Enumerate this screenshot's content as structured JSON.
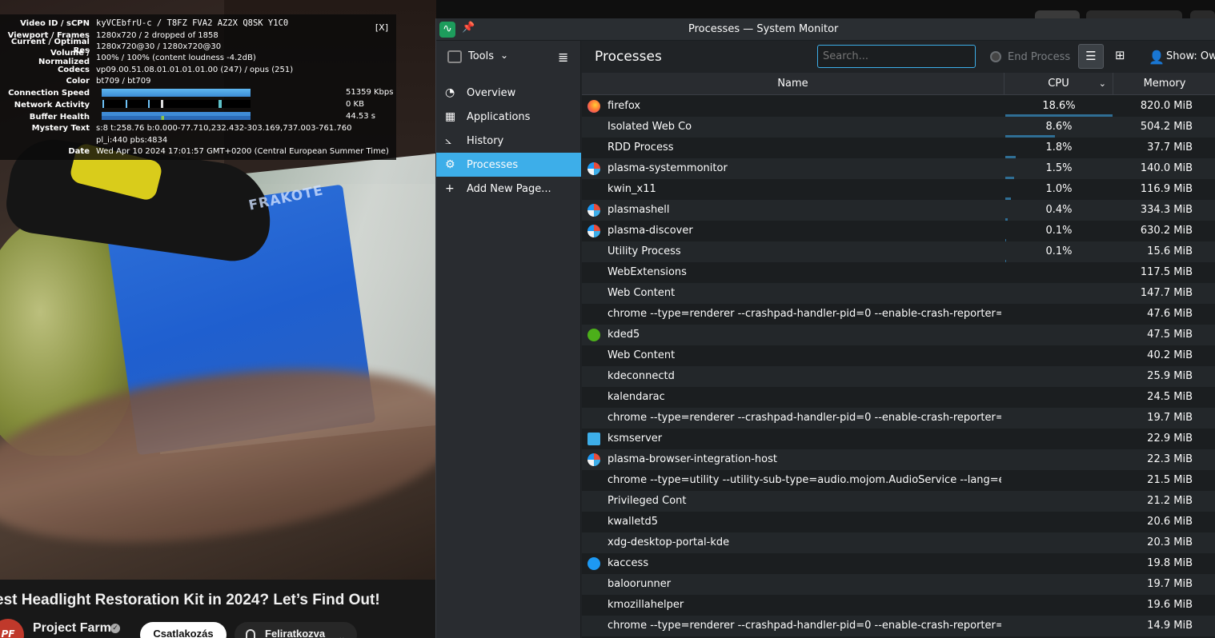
{
  "youtube": {
    "stats": {
      "close": "[X]",
      "rows": [
        {
          "k": "Video ID / sCPN",
          "v": "kyVCEbfrU-c / T8FZ FVA2 AZ2X Q8SK Y1C0"
        },
        {
          "k": "Viewport / Frames",
          "v": "1280x720 / 2 dropped of 1858"
        },
        {
          "k": "Current / Optimal Res",
          "v": "1280x720@30 / 1280x720@30"
        },
        {
          "k": "Volume / Normalized",
          "v": "100% / 100% (content loudness -4.2dB)"
        },
        {
          "k": "Codecs",
          "v": "vp09.00.51.08.01.01.01.01.00 (247) / opus (251)"
        },
        {
          "k": "Color",
          "v": "bt709 / bt709"
        }
      ],
      "connection_speed": {
        "k": "Connection Speed",
        "v": "51359 Kbps"
      },
      "network_activity": {
        "k": "Network Activity",
        "v": "0 KB"
      },
      "buffer_health": {
        "k": "Buffer Health",
        "v": "44.53 s"
      },
      "mystery": {
        "k": "Mystery Text",
        "v1": "s:8 t:258.76 b:0.000-77.710,232.432-303.169,737.003-761.760",
        "v2": "pl_i:440 pbs:4834"
      },
      "date": {
        "k": "Date",
        "v": "Wed Apr 10 2024 17:01:57 GMT+0200 (Central European Summer Time)"
      }
    },
    "video_overlay_text": "FRAKOTE",
    "title": "est Headlight Restoration Kit in 2024? Let’s Find Out!",
    "channel": {
      "avatar_text": "PF",
      "name": "Project Farm",
      "join": "Csatlakozás",
      "subscribe": "Feliratkozva"
    }
  },
  "sysmon": {
    "title": "Processes — System Monitor",
    "tools": "Tools",
    "nav": [
      {
        "label": "Overview",
        "icon": "overview-icon",
        "glyph": "◔"
      },
      {
        "label": "Applications",
        "icon": "applications-icon",
        "glyph": "▪"
      },
      {
        "label": "History",
        "icon": "history-icon",
        "glyph": "⌇"
      },
      {
        "label": "Processes",
        "icon": "processes-icon",
        "glyph": "⚙",
        "active": true
      },
      {
        "label": "Add New Page...",
        "icon": "plus-icon",
        "glyph": "+"
      }
    ],
    "page_title": "Processes",
    "search_placeholder": "Search...",
    "end_process": "End Process",
    "show": "Show: Own",
    "columns": {
      "name": "Name",
      "cpu": "CPU",
      "memory": "Memory"
    },
    "accent": "#3daee9",
    "processes": [
      {
        "name": "firefox",
        "cpu": "18.6%",
        "mem": "820.0 MiB",
        "icon": "firefox"
      },
      {
        "name": "Isolated Web Co",
        "cpu": "8.6%",
        "mem": "504.2 MiB",
        "icon": ""
      },
      {
        "name": "RDD Process",
        "cpu": "1.8%",
        "mem": "37.7 MiB",
        "icon": ""
      },
      {
        "name": "plasma-systemmonitor",
        "cpu": "1.5%",
        "mem": "140.0 MiB",
        "icon": "plasma"
      },
      {
        "name": "kwin_x11",
        "cpu": "1.0%",
        "mem": "116.9 MiB",
        "icon": ""
      },
      {
        "name": "plasmashell",
        "cpu": "0.4%",
        "mem": "334.3 MiB",
        "icon": "plasma"
      },
      {
        "name": "plasma-discover",
        "cpu": "0.1%",
        "mem": "630.2 MiB",
        "icon": "plasma"
      },
      {
        "name": "Utility Process",
        "cpu": "0.1%",
        "mem": "15.6 MiB",
        "icon": ""
      },
      {
        "name": "WebExtensions",
        "cpu": "",
        "mem": "117.5 MiB",
        "icon": ""
      },
      {
        "name": "Web Content",
        "cpu": "",
        "mem": "147.7 MiB",
        "icon": ""
      },
      {
        "name": "chrome --type=renderer --crashpad-handler-pid=0 --enable-crash-reporter=,sta...",
        "cpu": "",
        "mem": "47.6 MiB",
        "icon": ""
      },
      {
        "name": "kded5",
        "cpu": "",
        "mem": "47.5 MiB",
        "icon": "kded"
      },
      {
        "name": "Web Content",
        "cpu": "",
        "mem": "40.2 MiB",
        "icon": ""
      },
      {
        "name": "kdeconnectd",
        "cpu": "",
        "mem": "25.9 MiB",
        "icon": ""
      },
      {
        "name": "kalendarac",
        "cpu": "",
        "mem": "24.5 MiB",
        "icon": ""
      },
      {
        "name": "chrome --type=renderer --crashpad-handler-pid=0 --enable-crash-reporter=,sta...",
        "cpu": "",
        "mem": "19.7 MiB",
        "icon": ""
      },
      {
        "name": "ksmserver",
        "cpu": "",
        "mem": "22.9 MiB",
        "icon": "ksm"
      },
      {
        "name": "plasma-browser-integration-host",
        "cpu": "",
        "mem": "22.3 MiB",
        "icon": "plasma"
      },
      {
        "name": "chrome --type=utility --utility-sub-type=audio.mojom.AudioService --lang=en-US...",
        "cpu": "",
        "mem": "21.5 MiB",
        "icon": ""
      },
      {
        "name": "Privileged Cont",
        "cpu": "",
        "mem": "21.2 MiB",
        "icon": ""
      },
      {
        "name": "kwalletd5",
        "cpu": "",
        "mem": "20.6 MiB",
        "icon": ""
      },
      {
        "name": "xdg-desktop-portal-kde",
        "cpu": "",
        "mem": "20.3 MiB",
        "icon": ""
      },
      {
        "name": "kaccess",
        "cpu": "",
        "mem": "19.8 MiB",
        "icon": "kacc"
      },
      {
        "name": "baloorunner",
        "cpu": "",
        "mem": "19.7 MiB",
        "icon": ""
      },
      {
        "name": "kmozillahelper",
        "cpu": "",
        "mem": "19.6 MiB",
        "icon": ""
      },
      {
        "name": "chrome --type=renderer --crashpad-handler-pid=0 --enable-crash-reporter=,sta...",
        "cpu": "",
        "mem": "14.9 MiB",
        "icon": ""
      }
    ]
  }
}
